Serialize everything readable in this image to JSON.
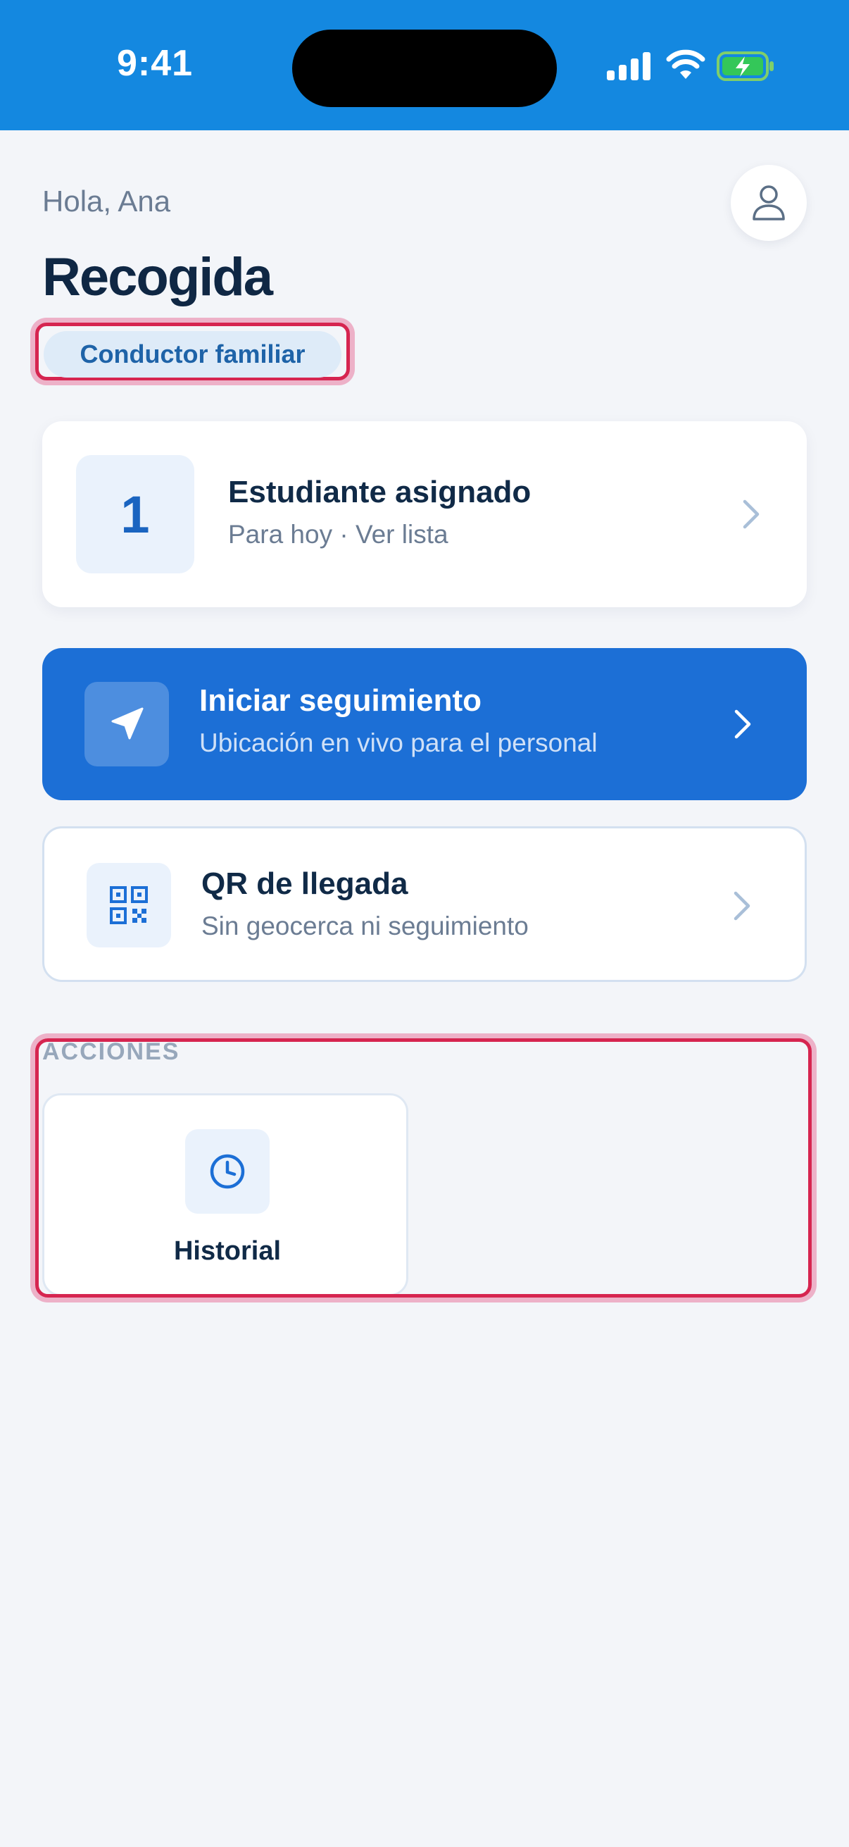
{
  "status_bar": {
    "time": "9:41"
  },
  "header": {
    "greeting": "Hola, Ana",
    "title": "Recogida",
    "role_badge": "Conductor familiar",
    "avatar_icon": "user-icon"
  },
  "students_card": {
    "count": "1",
    "title": "Estudiante asignado",
    "subtitle": "Para hoy · Ver lista",
    "chevron_icon": "chevron-right-icon"
  },
  "tracking_card": {
    "icon": "navigation-arrow-icon",
    "title": "Iniciar seguimiento",
    "subtitle": "Ubicación en vivo para el personal",
    "background_color": "#1c6fd6"
  },
  "qr_card": {
    "icon": "qr-code-icon",
    "title": "QR de llegada",
    "subtitle": "Sin geocerca ni seguimiento"
  },
  "actions": {
    "section_label": "ACCIONES",
    "items": [
      {
        "label": "Historial",
        "icon": "clock-icon"
      }
    ]
  },
  "colors": {
    "status_bar": "#1488e0",
    "accent": "#1c6fd6",
    "highlight_outline": "#d62550"
  }
}
